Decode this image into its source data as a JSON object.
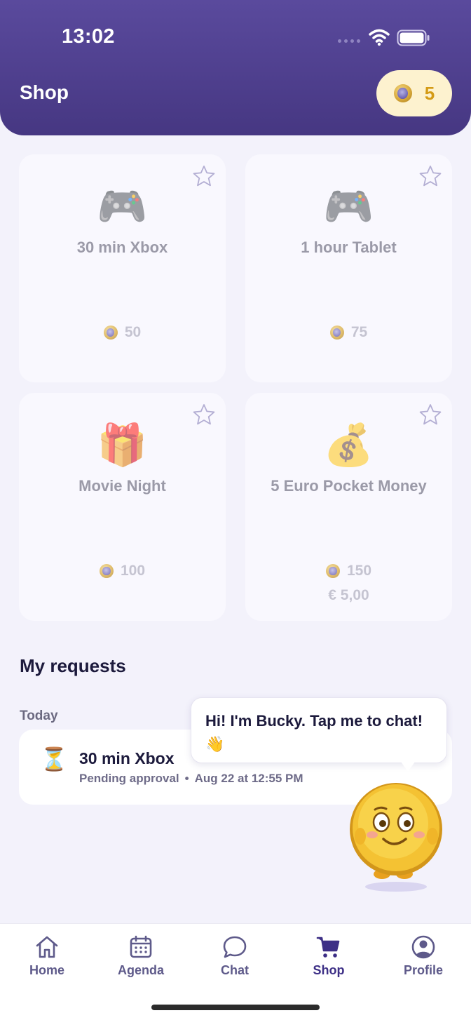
{
  "status_bar": {
    "time": "13:02"
  },
  "header": {
    "title": "Shop",
    "coin_balance": "5"
  },
  "rewards": [
    {
      "emoji": "🎮",
      "title": "30 min Xbox",
      "price": "50",
      "euro": ""
    },
    {
      "emoji": "🎮",
      "title": "1 hour Tablet",
      "price": "75",
      "euro": ""
    },
    {
      "emoji": "🎁",
      "title": "Movie Night",
      "price": "100",
      "euro": ""
    },
    {
      "emoji": "💰",
      "title": "5 Euro Pocket Money",
      "price": "150",
      "euro": "€ 5,00"
    }
  ],
  "requests": {
    "section_title": "My requests",
    "group_label": "Today",
    "items": [
      {
        "icon": "⏳",
        "title": "30 min Xbox",
        "status": "Pending approval",
        "separator": "•",
        "date": "Aug 22 at 12:55 PM"
      }
    ]
  },
  "mascot": {
    "bubble_text": "Hi! I'm Bucky. Tap me to chat! 👋"
  },
  "tabbar": {
    "items": [
      {
        "label": "Home",
        "icon": "home-icon"
      },
      {
        "label": "Agenda",
        "icon": "calendar-icon"
      },
      {
        "label": "Chat",
        "icon": "chat-icon"
      },
      {
        "label": "Shop",
        "icon": "cart-icon",
        "active": true
      },
      {
        "label": "Profile",
        "icon": "profile-icon"
      }
    ]
  },
  "colors": {
    "header": "#4f3f90",
    "accent_gold": "#d49b16",
    "text_dark": "#1c1a3c",
    "tab_active": "#3d2f86"
  }
}
